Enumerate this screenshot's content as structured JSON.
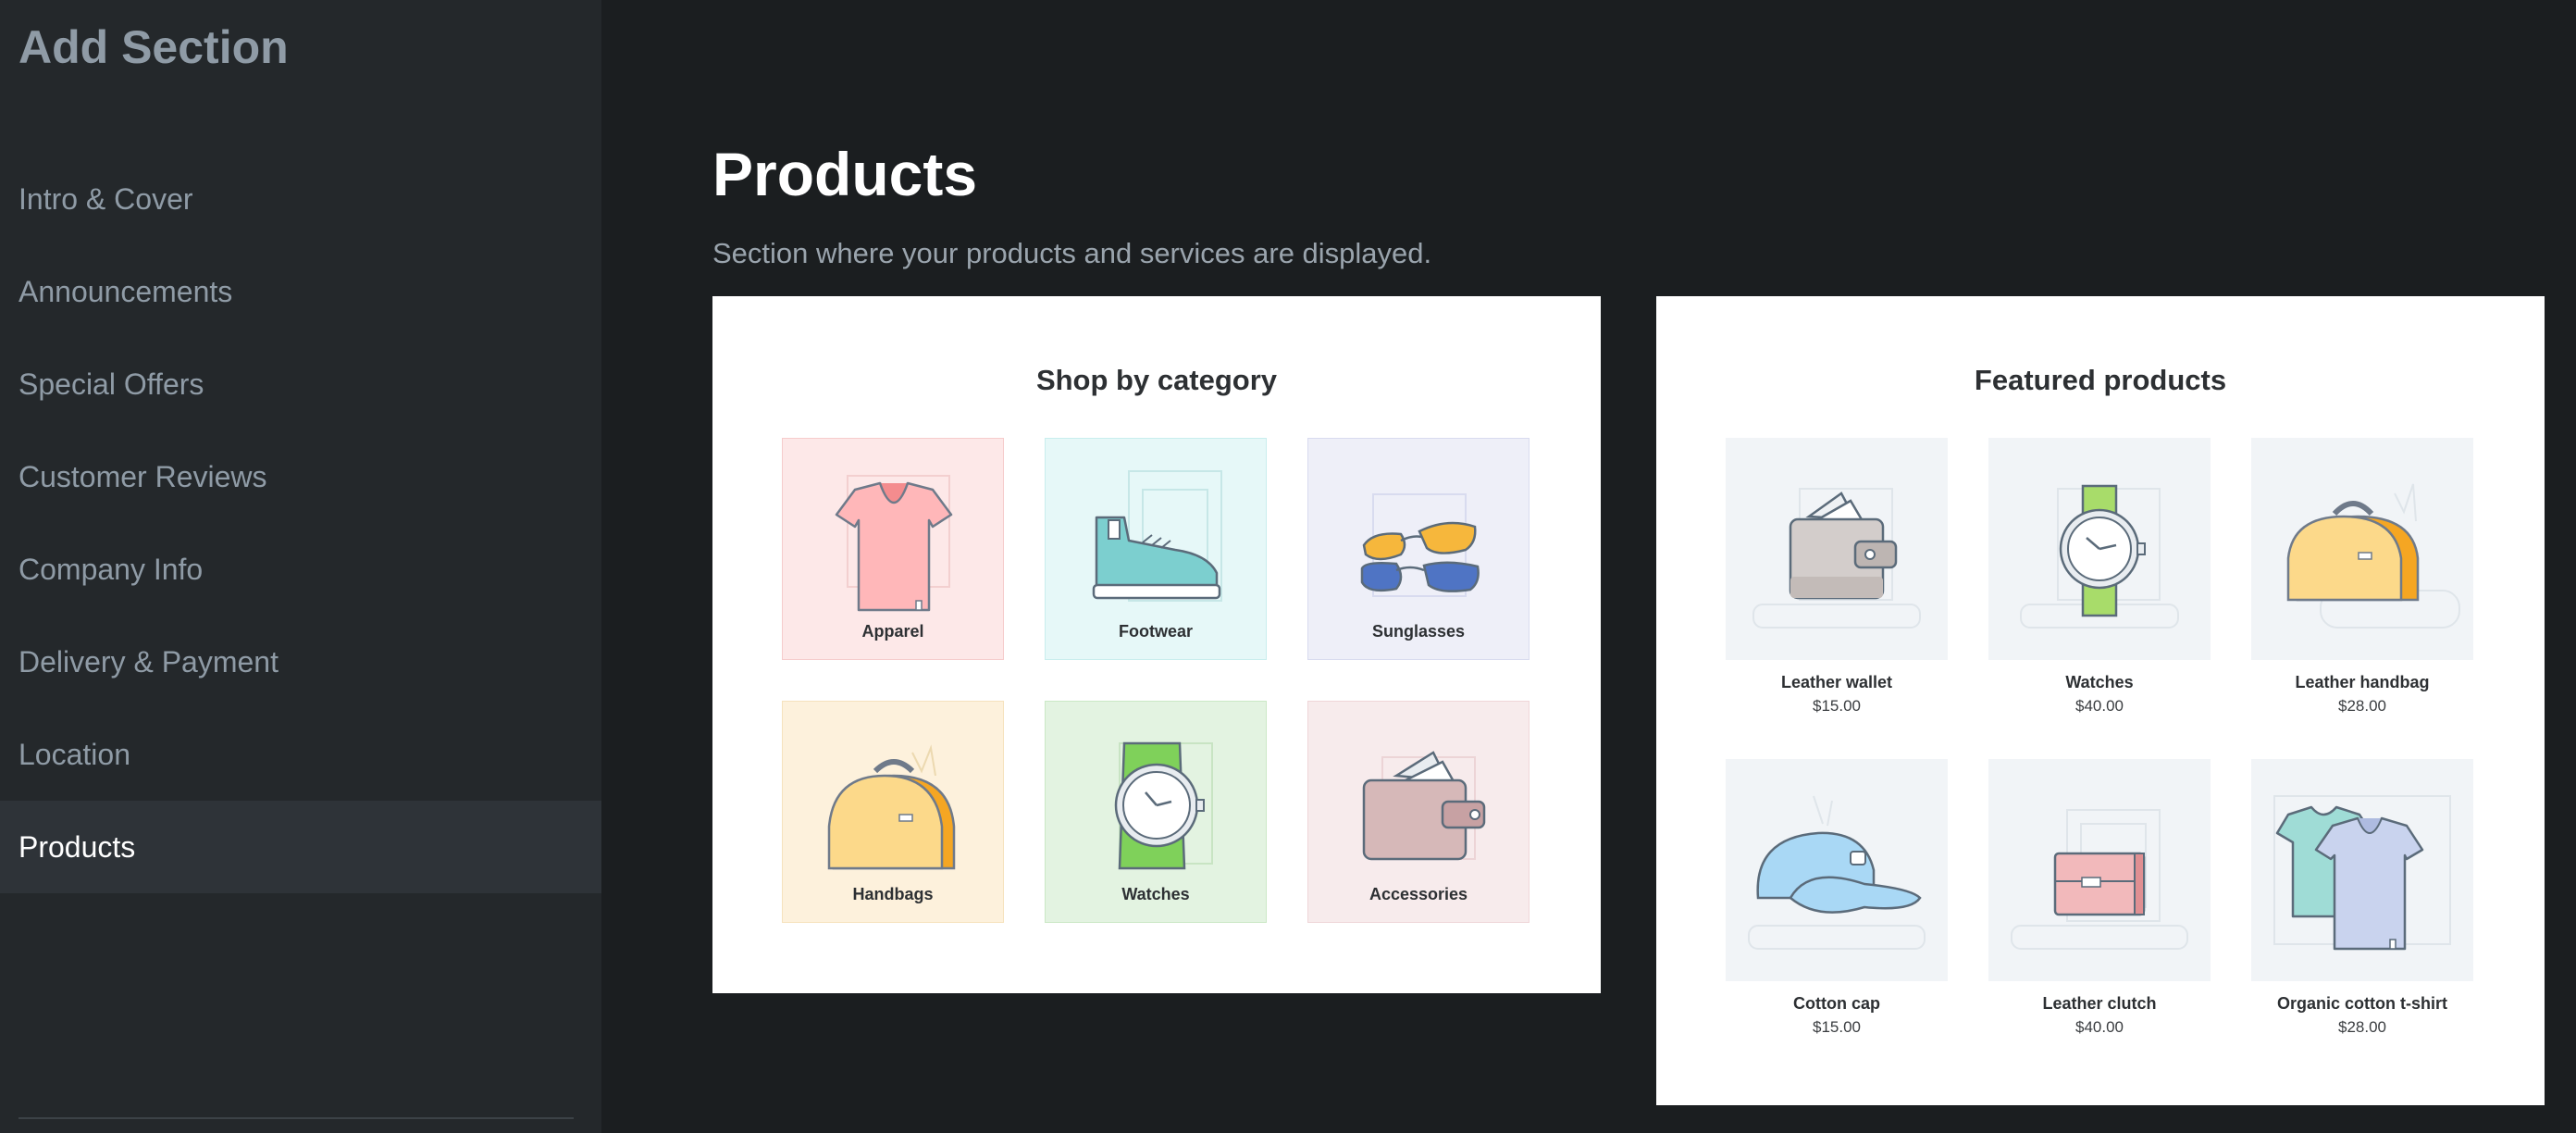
{
  "sidebar": {
    "title": "Add Section",
    "items": [
      {
        "label": "Intro & Cover",
        "active": false
      },
      {
        "label": "Announcements",
        "active": false
      },
      {
        "label": "Special Offers",
        "active": false
      },
      {
        "label": "Customer Reviews",
        "active": false
      },
      {
        "label": "Company Info",
        "active": false
      },
      {
        "label": "Delivery & Payment",
        "active": false
      },
      {
        "label": "Location",
        "active": false
      },
      {
        "label": "Products",
        "active": true
      }
    ]
  },
  "main": {
    "title": "Products",
    "subtitle": "Section where your products and services are displayed."
  },
  "category_card": {
    "title": "Shop by category",
    "tiles": [
      {
        "label": "Apparel",
        "icon": "tshirt-icon",
        "bg": "#fde8e8"
      },
      {
        "label": "Footwear",
        "icon": "sneaker-icon",
        "bg": "#e6f8f8"
      },
      {
        "label": "Sunglasses",
        "icon": "sunglasses-icon",
        "bg": "#eeeff8"
      },
      {
        "label": "Handbags",
        "icon": "handbag-icon",
        "bg": "#fdf1dc"
      },
      {
        "label": "Watches",
        "icon": "watch-icon",
        "bg": "#e3f3e1"
      },
      {
        "label": "Accessories",
        "icon": "wallet-icon",
        "bg": "#f7ebec"
      }
    ]
  },
  "featured_card": {
    "title": "Featured products",
    "products": [
      {
        "name": "Leather wallet",
        "price": "$15.00",
        "icon": "wallet-icon"
      },
      {
        "name": "Watches",
        "price": "$40.00",
        "icon": "watch-icon"
      },
      {
        "name": "Leather handbag",
        "price": "$28.00",
        "icon": "handbag-icon"
      },
      {
        "name": "Cotton cap",
        "price": "$15.00",
        "icon": "cap-icon"
      },
      {
        "name": "Leather clutch",
        "price": "$40.00",
        "icon": "clutch-icon"
      },
      {
        "name": "Organic cotton t-shirt",
        "price": "$28.00",
        "icon": "tshirt-icon"
      }
    ]
  }
}
